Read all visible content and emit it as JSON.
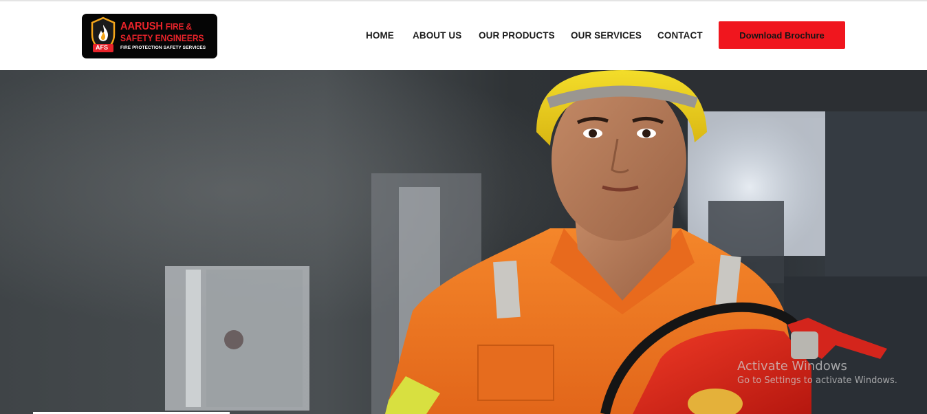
{
  "logo": {
    "line1_main": "AARUSH",
    "line1_small": "FIRE &",
    "line2": "SAFETY ENGINEERS",
    "tagline": "FIRE PROTECTION SAFETY SERVICES",
    "badge": "AFS"
  },
  "nav": {
    "items": [
      {
        "label": "HOME"
      },
      {
        "label": "ABOUT US"
      },
      {
        "label": "OUR PRODUCTS"
      },
      {
        "label": "OUR SERVICES"
      },
      {
        "label": "CONTACT"
      }
    ],
    "cta_label": "Download Brochure"
  },
  "hero": {
    "image": "firefighter-with-extinguisher-photo"
  },
  "watermark": {
    "title": "Activate Windows",
    "subtitle": "Go to Settings to activate Windows."
  },
  "colors": {
    "brand_red": "#f0161e",
    "logo_bg": "#050505",
    "nav_text": "#1c1c1c"
  }
}
